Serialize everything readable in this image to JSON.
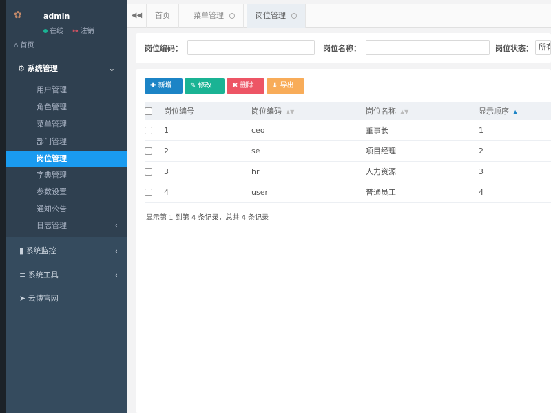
{
  "user": {
    "name": "admin",
    "status": "在线",
    "logout": "注销"
  },
  "nav": {
    "home": "首页",
    "system": "系统管理",
    "sub_items": [
      "用户管理",
      "角色管理",
      "菜单管理",
      "部门管理",
      "岗位管理",
      "字典管理",
      "参数设置",
      "通知公告",
      "日志管理"
    ],
    "monitor": "系统监控",
    "tools": "系统工具",
    "website": "云博官网"
  },
  "tabs": [
    "首页",
    "菜单管理",
    "岗位管理"
  ],
  "search": {
    "code_label": "岗位编码：",
    "name_label": "岗位名称：",
    "status_label": "岗位状态：",
    "status_value": "所有"
  },
  "toolbar": {
    "add": "新增",
    "edit": "修改",
    "delete": "删除",
    "export": "导出"
  },
  "table": {
    "headers": [
      "岗位编号",
      "岗位编码",
      "岗位名称",
      "显示顺序"
    ],
    "rows": [
      [
        "1",
        "ceo",
        "董事长",
        "1"
      ],
      [
        "2",
        "se",
        "项目经理",
        "2"
      ],
      [
        "3",
        "hr",
        "人力资源",
        "3"
      ],
      [
        "4",
        "user",
        "普通员工",
        "4"
      ]
    ]
  },
  "pager": {
    "info": "显示第 1 到第 4 条记录，总共 4 条记录"
  },
  "colors": {
    "sidebar": "#2f4050",
    "active": "#1a9bf0",
    "add": "#1c84c6",
    "edit": "#1ab394",
    "delete": "#ed5565",
    "export": "#f8ac59"
  }
}
